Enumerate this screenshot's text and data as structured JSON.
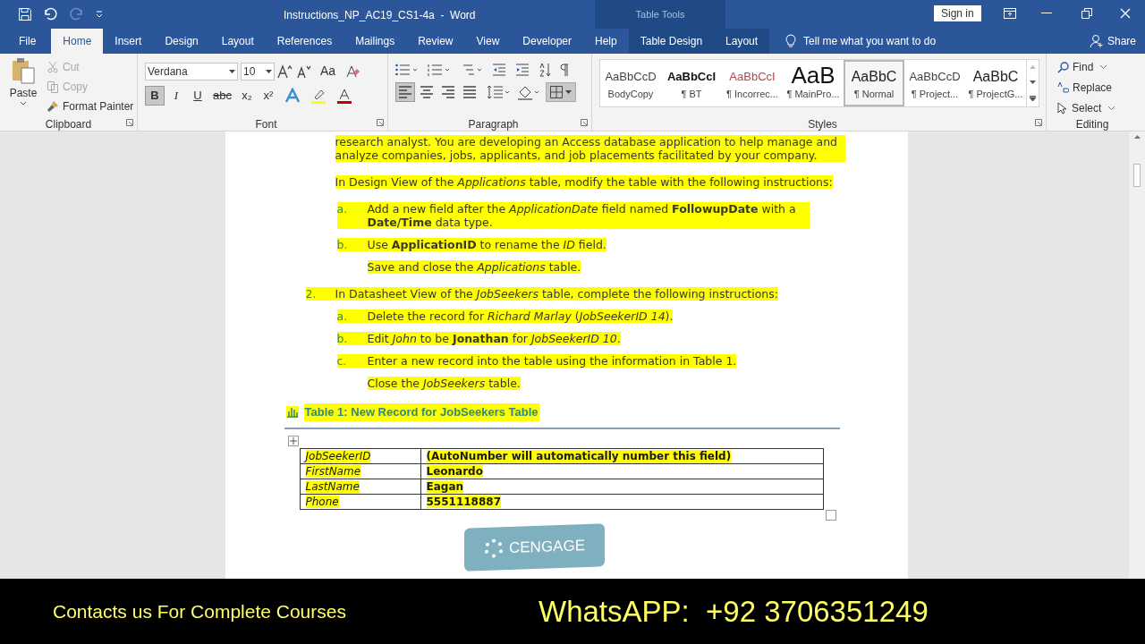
{
  "title_bar": {
    "title": "Instructions_NP_AC19_CS1-4a  -  Word",
    "context_label": "Table Tools",
    "sign_in": "Sign in"
  },
  "tabs": [
    {
      "label": "File",
      "selected": false,
      "kind": "main"
    },
    {
      "label": "Home",
      "selected": true,
      "kind": "main"
    },
    {
      "label": "Insert",
      "selected": false,
      "kind": "main"
    },
    {
      "label": "Design",
      "selected": false,
      "kind": "main"
    },
    {
      "label": "Layout",
      "selected": false,
      "kind": "main"
    },
    {
      "label": "References",
      "selected": false,
      "kind": "main"
    },
    {
      "label": "Mailings",
      "selected": false,
      "kind": "main"
    },
    {
      "label": "Review",
      "selected": false,
      "kind": "main"
    },
    {
      "label": "View",
      "selected": false,
      "kind": "main"
    },
    {
      "label": "Developer",
      "selected": false,
      "kind": "main"
    },
    {
      "label": "Help",
      "selected": false,
      "kind": "main"
    },
    {
      "label": "Table Design",
      "selected": false,
      "kind": "context"
    },
    {
      "label": "Layout",
      "selected": false,
      "kind": "context"
    }
  ],
  "tell_me": "Tell me what you want to do",
  "share": "Share",
  "clipboard": {
    "paste": "Paste",
    "cut": "Cut",
    "copy": "Copy",
    "format_painter": "Format Painter",
    "cut_disabled": true,
    "copy_disabled": true,
    "group": "Clipboard"
  },
  "font": {
    "name": "Verdana",
    "size": "10",
    "case_button": "Aa",
    "group": "Font",
    "format_buttons": [
      {
        "label": "B",
        "kind": "bold",
        "pressed": true
      },
      {
        "label": "I",
        "kind": "italic",
        "pressed": false
      },
      {
        "label": "U",
        "kind": "underline",
        "pressed": false
      },
      {
        "label": "abc",
        "kind": "strike",
        "pressed": false
      },
      {
        "label": "x₂",
        "kind": "sub",
        "pressed": false
      },
      {
        "label": "x²",
        "kind": "sup",
        "pressed": false
      }
    ]
  },
  "paragraph": {
    "group": "Paragraph",
    "align": [
      {
        "kind": "left",
        "pressed": true
      },
      {
        "kind": "center",
        "pressed": false
      },
      {
        "kind": "right",
        "pressed": false
      },
      {
        "kind": "justify",
        "pressed": false
      }
    ]
  },
  "styles": {
    "group": "Styles",
    "items": [
      {
        "sample": "AaBbCcD",
        "name": "BodyCopy",
        "kind": "plain",
        "selected": false
      },
      {
        "sample": "AaBbCcI",
        "name": "¶ BT",
        "kind": "bold",
        "selected": false
      },
      {
        "sample": "AaBbCcI",
        "name": "¶ Incorrec...",
        "kind": "red",
        "selected": false
      },
      {
        "sample": "AaB",
        "name": "¶ MainPro...",
        "kind": "large",
        "selected": false
      },
      {
        "sample": "AaBbC",
        "name": "¶ Normal",
        "kind": "medium",
        "selected": true
      },
      {
        "sample": "AaBbCcD",
        "name": "¶ Project...",
        "kind": "plain",
        "selected": false
      },
      {
        "sample": "AaBbC",
        "name": "¶ ProjectG...",
        "kind": "medium",
        "selected": false
      }
    ]
  },
  "editing": {
    "group": "Editing",
    "find": "Find",
    "replace": "Replace",
    "select": "Select"
  },
  "document": {
    "blocks": [
      {
        "kind": "para",
        "text": "research analyst. You are developing an Access database application to help manage and analyze companies, jobs, applicants, and job placements facilitated by your company."
      },
      {
        "kind": "para",
        "text": "In Design View of the *Applications* table, modify the table with the following instructions:"
      },
      {
        "kind": "item",
        "marker": "a.",
        "text": "Add a new field after the *ApplicationDate* field named **FollowupDate** with a **Date/Time** data type."
      },
      {
        "kind": "item",
        "marker": "b.",
        "text": "Use **ApplicationID** to rename the *ID* field."
      },
      {
        "kind": "sub",
        "text": "Save and close the *Applications* table."
      },
      {
        "kind": "number",
        "marker": "2.",
        "text": "In Datasheet View of the *JobSeekers* table, complete the following instructions:"
      },
      {
        "kind": "item",
        "marker": "a.",
        "text": "Delete the record for *Richard Marlay* (*JobSeekerID 14*)."
      },
      {
        "kind": "item",
        "marker": "b.",
        "text": "Edit *John* to be **Jonathan** for *JobSeekerID 10*."
      },
      {
        "kind": "item",
        "marker": "c.",
        "text": "Enter a new record into the table using the information in Table 1."
      },
      {
        "kind": "sub",
        "text": "Close the *JobSeekers* table."
      }
    ],
    "table_caption": "Table 1: New Record for JobSeekers Table",
    "table_rows": [
      {
        "field": "JobSeekerID",
        "value": "(AutoNumber will automatically number this field)"
      },
      {
        "field": "FirstName",
        "value": "Leonardo"
      },
      {
        "field": "LastName",
        "value": "Eagan"
      },
      {
        "field": "Phone",
        "value": "5551118887"
      }
    ],
    "logo": "CENGAGE"
  },
  "banner": {
    "left": "Contacts us For Complete Courses",
    "right": "WhatsAPP:  +92 3706351249"
  }
}
